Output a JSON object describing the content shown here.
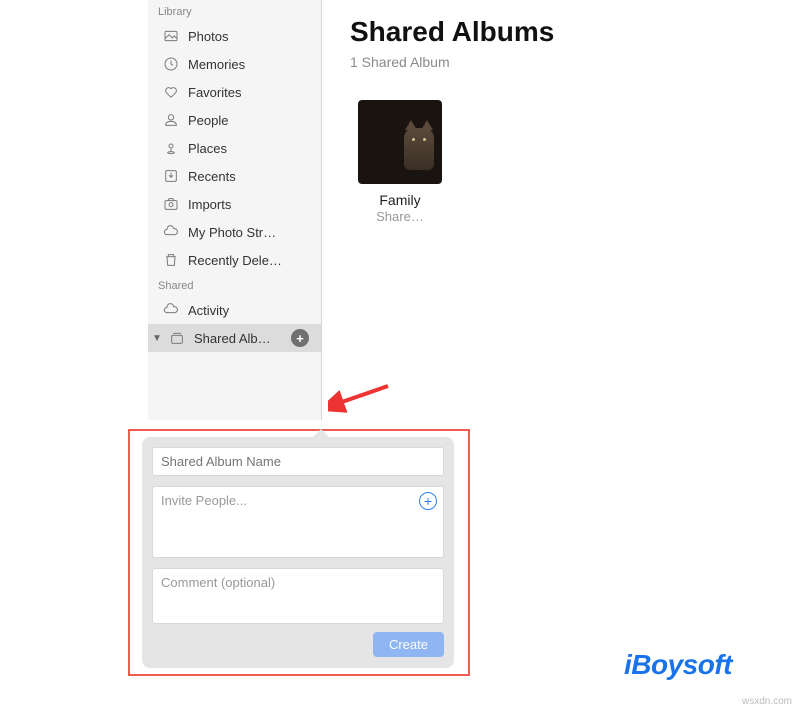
{
  "sidebar": {
    "sections": [
      {
        "header": "Library",
        "items": [
          {
            "icon": "photos-icon",
            "label": "Photos"
          },
          {
            "icon": "memories-icon",
            "label": "Memories"
          },
          {
            "icon": "favorites-icon",
            "label": "Favorites"
          },
          {
            "icon": "people-icon",
            "label": "People"
          },
          {
            "icon": "places-icon",
            "label": "Places"
          },
          {
            "icon": "recents-icon",
            "label": "Recents"
          },
          {
            "icon": "imports-icon",
            "label": "Imports"
          },
          {
            "icon": "cloud-icon",
            "label": "My Photo Str…"
          },
          {
            "icon": "trash-icon",
            "label": "Recently Dele…"
          }
        ]
      },
      {
        "header": "Shared",
        "items": [
          {
            "icon": "cloud-icon",
            "label": "Activity"
          },
          {
            "icon": "album-stack-icon",
            "label": "Shared Alb…",
            "selected": true,
            "plus": true,
            "disclosure": true
          }
        ]
      }
    ]
  },
  "main": {
    "title": "Shared Albums",
    "subtitle": "1 Shared Album",
    "albums": [
      {
        "name": "Family",
        "subtitle": "Share…"
      }
    ]
  },
  "popover": {
    "name_placeholder": "Shared Album Name",
    "invite_placeholder": "Invite People...",
    "comment_placeholder": "Comment (optional)",
    "create_label": "Create"
  },
  "watermark": {
    "brand": "iBoysoft",
    "site": "wsxdn.com"
  }
}
